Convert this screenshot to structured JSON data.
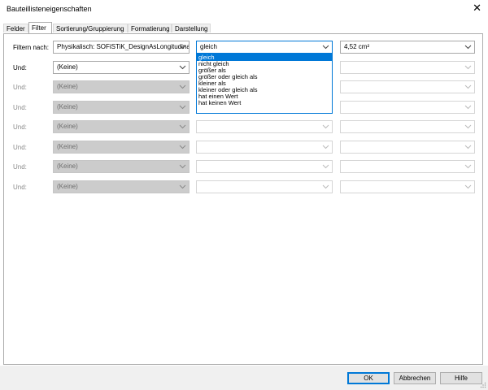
{
  "window": {
    "title": "Bauteillisteneigenschaften",
    "close_glyph": "✕"
  },
  "tabs": [
    {
      "label": "Felder"
    },
    {
      "label": "Filter"
    },
    {
      "label": "Sortierung/Gruppierung"
    },
    {
      "label": "Formatierung"
    },
    {
      "label": "Darstellung"
    }
  ],
  "filters": {
    "row0": {
      "label": "Filtern nach:",
      "field": "Physikalisch: SOFiSTiK_DesignAsLongitudinal",
      "condition": "gleich",
      "value": "4,52 cm²"
    },
    "row1": {
      "label": "Und:",
      "field": "(Keine)"
    },
    "row2": {
      "label": "Und:",
      "field": "(Keine)"
    },
    "row3": {
      "label": "Und:",
      "field": "(Keine)"
    },
    "row4": {
      "label": "Und:",
      "field": "(Keine)"
    },
    "row5": {
      "label": "Und:",
      "field": "(Keine)"
    },
    "row6": {
      "label": "Und:",
      "field": "(Keine)"
    },
    "row7": {
      "label": "Und:",
      "field": "(Keine)"
    }
  },
  "condition_options": [
    "gleich",
    "nicht gleich",
    "größer als",
    "größer oder gleich als",
    "kleiner als",
    "kleiner oder gleich als",
    "hat einen Wert",
    "hat keinen Wert"
  ],
  "buttons": {
    "ok": "OK",
    "cancel": "Abbrechen",
    "help": "Hilfe"
  },
  "colors": {
    "accent": "#0078d7",
    "disabled_fill": "#cccccc"
  }
}
